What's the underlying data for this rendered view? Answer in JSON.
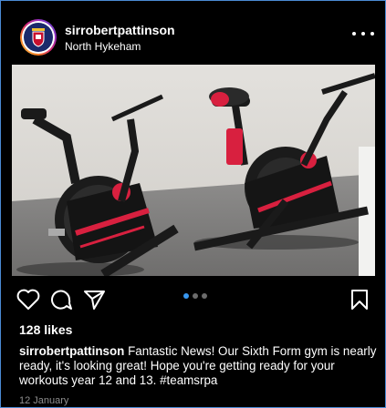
{
  "post": {
    "username": "sirrobertpattinson",
    "location": "North Hykeham",
    "likes": "128 likes",
    "caption_user": "sirrobertpattinson",
    "caption_text": "Fantastic News! Our Sixth Form gym is nearly ready, it's looking great! Hope you're getting ready for your workouts year 12 and 13. #teamsrpa",
    "date": "12 January",
    "carousel": {
      "total": 3,
      "active": 1
    }
  },
  "icons": {
    "like": "heart-icon",
    "comment": "comment-icon",
    "share": "share-icon",
    "save": "bookmark-icon",
    "more": "more-options-icon"
  },
  "colors": {
    "background": "#000000",
    "text": "#ffffff",
    "muted": "#8e8e8e",
    "carousel_active": "#3897f0",
    "frame_border": "#4a8ad4",
    "bike_accent": "#d8203f"
  }
}
